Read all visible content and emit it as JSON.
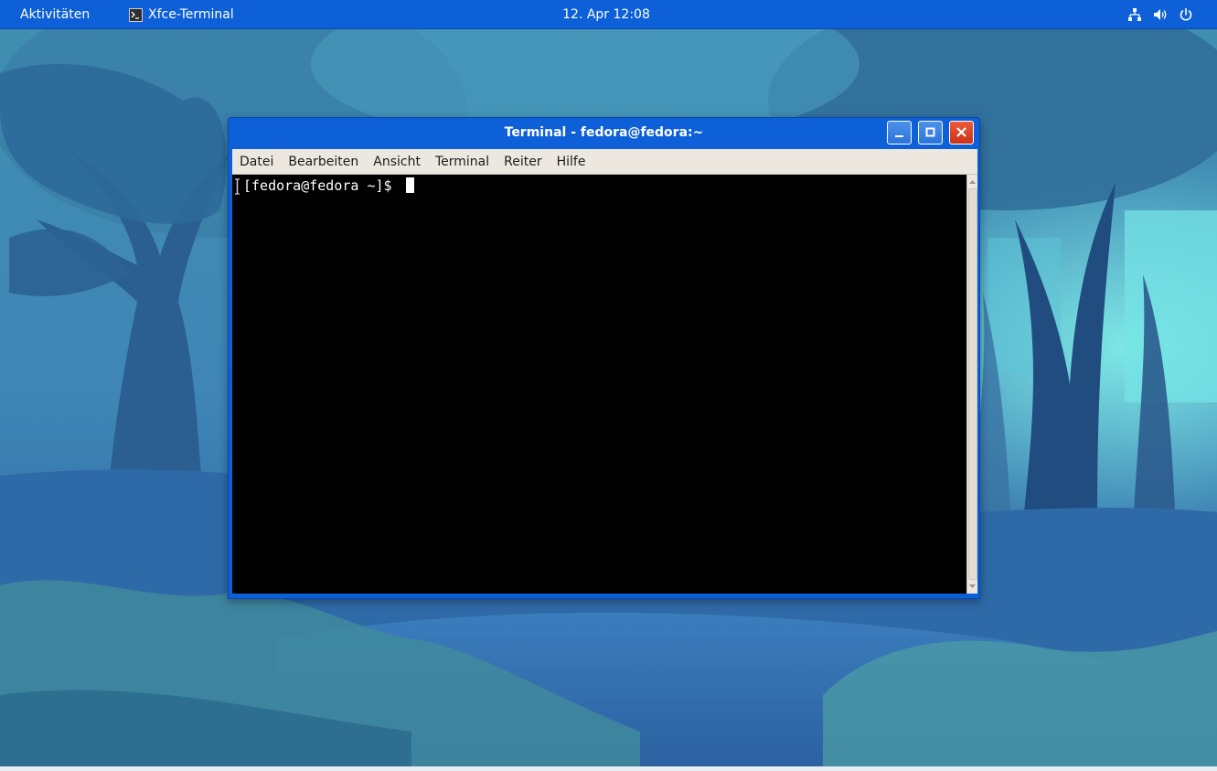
{
  "panel": {
    "activities_label": "Aktivitäten",
    "app_name": "Xfce-Terminal",
    "app_icon": "terminal-icon",
    "clock": "12. Apr  12:08",
    "status_icons": [
      "network-icon",
      "volume-icon",
      "power-icon"
    ]
  },
  "window": {
    "title": "Terminal - fedora@fedora:~",
    "buttons": [
      "minimize",
      "maximize",
      "close"
    ],
    "menu": [
      "Datei",
      "Bearbeiten",
      "Ansicht",
      "Terminal",
      "Reiter",
      "Hilfe"
    ],
    "terminal": {
      "prompt": "[fedora@fedora ~]$ "
    }
  },
  "colors": {
    "panel_bg": "#0d60d8",
    "terminal_bg": "#000000",
    "terminal_fg": "#ffffff",
    "close_button": "#d9402a"
  }
}
